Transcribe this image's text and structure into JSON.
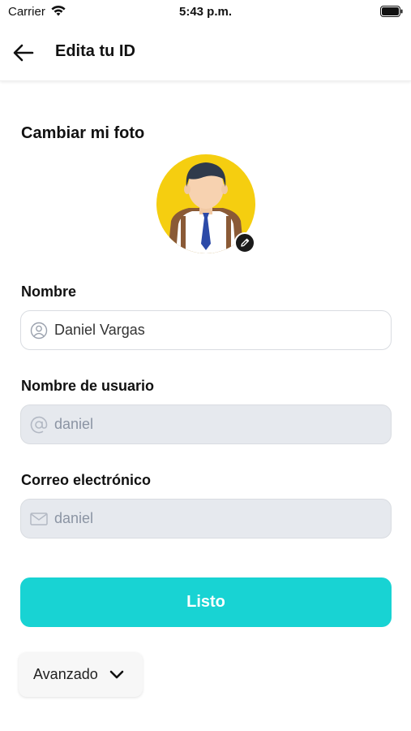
{
  "status_bar": {
    "carrier": "Carrier",
    "time": "5:43 p.m."
  },
  "header": {
    "title": "Edita tu ID",
    "back_icon": "arrow-left-icon"
  },
  "photo": {
    "title": "Cambiar mi foto",
    "edit_icon": "pencil-icon"
  },
  "form": {
    "name": {
      "label": "Nombre",
      "value": "Daniel Vargas",
      "icon": "user-icon",
      "enabled": true
    },
    "username": {
      "label": "Nombre de usuario",
      "value": "daniel",
      "icon": "at-icon",
      "enabled": false
    },
    "email": {
      "label": "Correo electrónico",
      "value": "daniel",
      "icon": "mail-icon",
      "enabled": false
    }
  },
  "actions": {
    "done_label": "Listo",
    "advanced_label": "Avanzado",
    "advanced_icon": "chevron-down-icon"
  },
  "colors": {
    "accent": "#18D3D3",
    "avatar_bg": "#F5CE10",
    "disabled_field": "#E6E9EE"
  }
}
